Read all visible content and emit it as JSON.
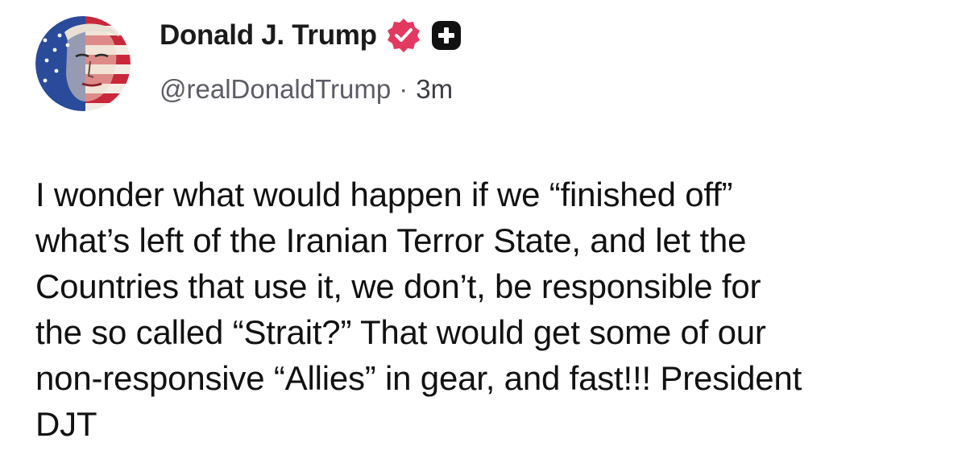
{
  "post": {
    "author": {
      "display_name": "Donald J. Trump",
      "handle": "@realDonaldTrump",
      "verified_icon": "verified-badge-icon",
      "plus_icon": "plus-badge-icon"
    },
    "separator": "·",
    "timestamp": "3m",
    "text": "I wonder what would happen if we “finished off”\nwhat’s left of the Iranian Terror State, and let the\nCountries that use it, we don’t, be responsible for\nthe so called “Strait?” That would get some of our\nnon-responsive “Allies” in gear, and fast!!! President\nDJT"
  },
  "colors": {
    "verified_badge": "#e3385f",
    "plus_badge": "#111111",
    "meta_text": "#5c5c66"
  }
}
